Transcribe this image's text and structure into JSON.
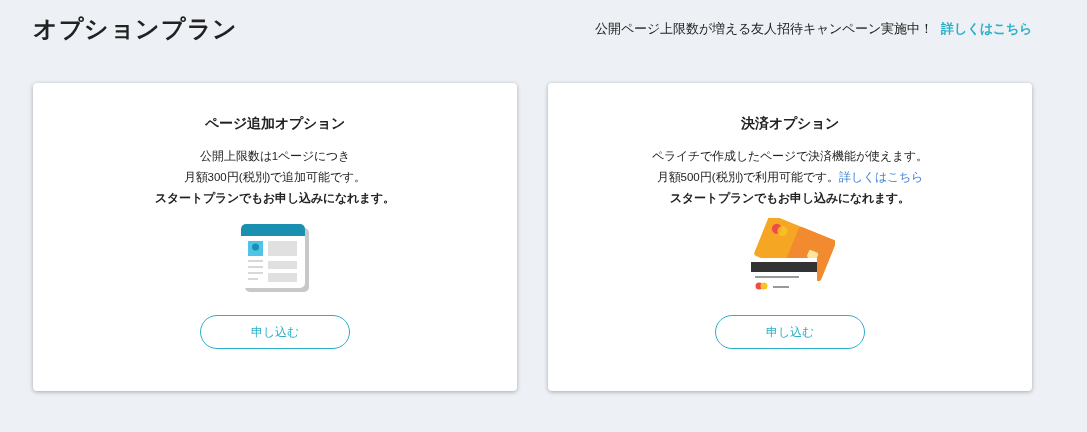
{
  "header": {
    "title": "オプションプラン",
    "notice": "公開ページ上限数が増える友人招待キャンペーン実施中！",
    "notice_link": "詳しくはこちら"
  },
  "cards": [
    {
      "title": "ページ追加オプション",
      "kind": "document",
      "lines": [
        {
          "bold": false,
          "segments": [
            {
              "kind": "plain",
              "text": "公開上限数は1ページにつき"
            }
          ]
        },
        {
          "bold": false,
          "segments": [
            {
              "kind": "plain",
              "text": "月額300円(税別)で追加可能です。"
            }
          ]
        },
        {
          "bold": true,
          "segments": [
            {
              "kind": "plain",
              "text": "スタートプランでもお申し込みになれます。"
            }
          ]
        }
      ],
      "button": "申し込む"
    },
    {
      "title": "決済オプション",
      "kind": "credit-card",
      "lines": [
        {
          "bold": false,
          "segments": [
            {
              "kind": "plain",
              "text": "ペライチで作成したページで決済機能が使えます。"
            }
          ]
        },
        {
          "bold": false,
          "segments": [
            {
              "kind": "plain",
              "text": "月額500円(税別)で利用可能です。"
            },
            {
              "kind": "link",
              "text": "詳しくはこちら"
            }
          ]
        },
        {
          "bold": true,
          "segments": [
            {
              "kind": "plain",
              "text": "スタートプランでもお申し込みになれます。"
            }
          ]
        }
      ],
      "button": "申し込む"
    }
  ]
}
